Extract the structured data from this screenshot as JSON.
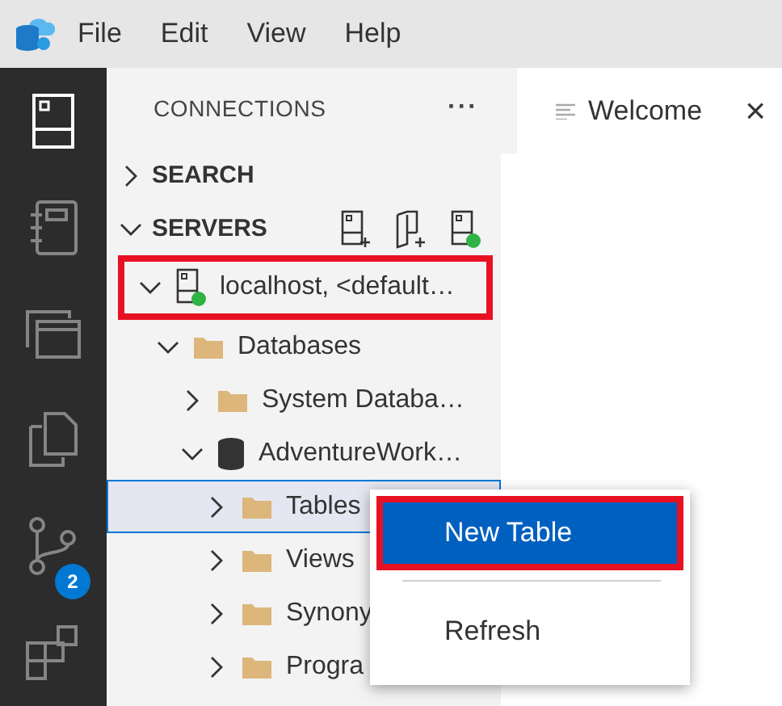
{
  "menu_bar": [
    "File",
    "Edit",
    "View",
    "Help"
  ],
  "activity_bar": [
    {
      "kind": "server",
      "selected": true
    },
    {
      "kind": "notebook",
      "selected": false
    },
    {
      "kind": "windows",
      "selected": false
    },
    {
      "kind": "copies",
      "selected": false
    },
    {
      "kind": "git",
      "selected": false,
      "badge": "2"
    },
    {
      "kind": "extensions",
      "selected": false
    }
  ],
  "sidebar": {
    "title": "CONNECTIONS",
    "more": "···",
    "sections": [
      {
        "label": "SEARCH",
        "expanded": false
      },
      {
        "label": "SERVERS",
        "expanded": true
      }
    ],
    "tree": [
      {
        "label": "localhost, <default…",
        "kind": "server",
        "expanded": true,
        "selected": false,
        "highlight": true,
        "children": [
          {
            "label": "Databases",
            "kind": "folder",
            "expanded": true,
            "selected": false,
            "highlight": false,
            "children": [
              {
                "label": "System Databa…",
                "kind": "folder",
                "expanded": false,
                "selected": false,
                "highlight": false
              },
              {
                "label": "AdventureWork…",
                "kind": "database",
                "expanded": true,
                "selected": false,
                "highlight": false,
                "children": [
                  {
                    "label": "Tables",
                    "kind": "folder",
                    "expanded": false,
                    "selected": true,
                    "highlight": false
                  },
                  {
                    "label": "Views",
                    "kind": "folder",
                    "expanded": false,
                    "selected": false,
                    "highlight": false
                  },
                  {
                    "label": "Synony",
                    "kind": "folder",
                    "expanded": false,
                    "selected": false,
                    "highlight": false
                  },
                  {
                    "label": "Progra",
                    "kind": "folder",
                    "expanded": false,
                    "selected": false,
                    "highlight": false
                  }
                ]
              }
            ]
          }
        ]
      }
    ]
  },
  "tab": {
    "label": "Welcome",
    "close": "×"
  },
  "context_menu": [
    {
      "kind": "item",
      "label": "New Table",
      "selected": true,
      "highlight": true
    },
    {
      "kind": "separator"
    },
    {
      "kind": "item",
      "label": "Refresh",
      "selected": false,
      "highlight": false
    }
  ]
}
